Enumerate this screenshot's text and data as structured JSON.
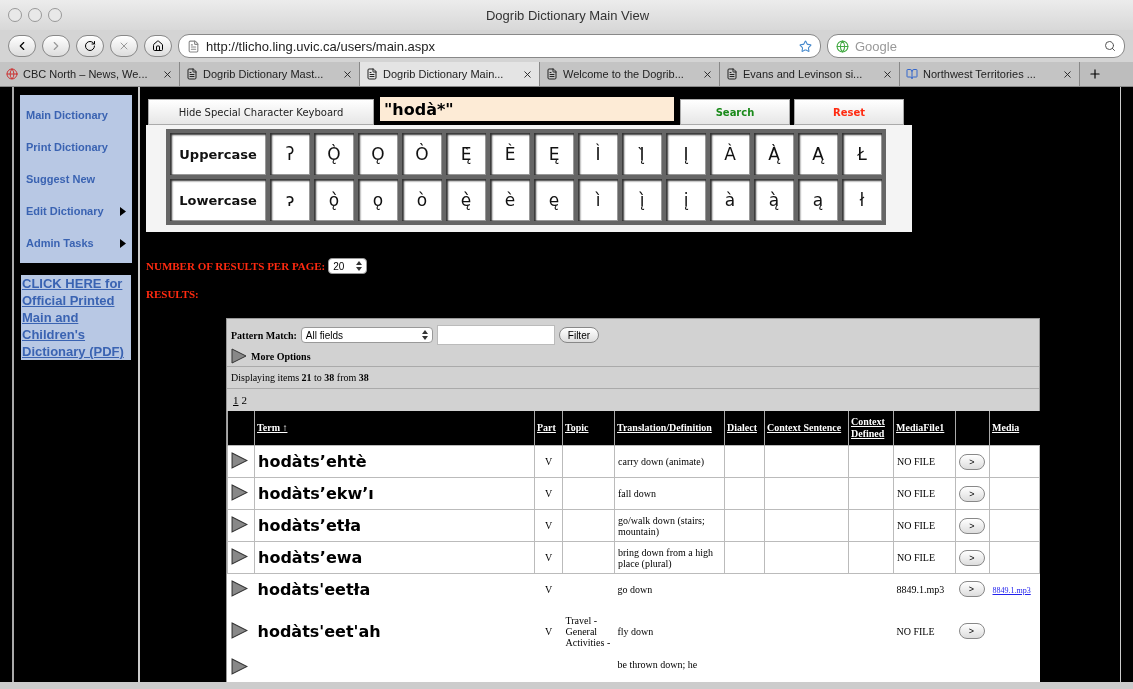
{
  "window": {
    "title": "Dogrib Dictionary Main View"
  },
  "toolbar": {
    "url": "http://tlicho.ling.uvic.ca/users/main.aspx",
    "search_placeholder": "Google"
  },
  "tabs": [
    {
      "label": "CBC North – News, We...",
      "selected": false,
      "kind": "site"
    },
    {
      "label": "Dogrib Dictionary Mast...",
      "selected": false,
      "kind": "page"
    },
    {
      "label": "Dogrib Dictionary Main...",
      "selected": true,
      "kind": "page"
    },
    {
      "label": "Welcome to the Dogrib...",
      "selected": false,
      "kind": "page"
    },
    {
      "label": "Evans and Levinson si...",
      "selected": false,
      "kind": "page"
    },
    {
      "label": "Northwest Territories ...",
      "selected": false,
      "kind": "book"
    }
  ],
  "sidebar": {
    "items": [
      {
        "label": "Main Dictionary",
        "has_submenu": false
      },
      {
        "label": "Print Dictionary",
        "has_submenu": false
      },
      {
        "label": "Suggest New",
        "has_submenu": false
      },
      {
        "label": "Edit Dictionary",
        "has_submenu": true
      },
      {
        "label": "Admin Tasks",
        "has_submenu": true
      }
    ],
    "pdf_link": "CLICK HERE for Official Printed Main and Children's Dictionary (PDF)"
  },
  "search": {
    "keyboard_toggle": "Hide Special Character Keyboard",
    "query": "\"hodà*\"",
    "search_button": "Search",
    "reset_button": "Reset"
  },
  "keyboard": [
    {
      "label": "Uppercase",
      "keys": [
        "ʔ",
        "Ǫ̀",
        "Ǫ",
        "Ò",
        "Ę̀",
        "È",
        "Ę",
        "Ì",
        "Į̀",
        "Į",
        "À",
        "Ą̀",
        "Ą",
        "Ł"
      ]
    },
    {
      "label": "Lowercase",
      "keys": [
        "ɂ",
        "ǫ̀",
        "ǫ",
        "ò",
        "ę̀",
        "è",
        "ę",
        "ì",
        "į̀",
        "į",
        "à",
        "ą̀",
        "ą",
        "ł"
      ]
    }
  ],
  "results_per_page": {
    "label": "NUMBER OF RESULTS PER PAGE:",
    "value": "20"
  },
  "results_label": "RESULTS:",
  "grid": {
    "pattern_label": "Pattern Match:",
    "pattern_select": "All fields",
    "filter_button": "Filter",
    "more_options": "More Options",
    "displaying": "Displaying items **21** to **38** from **38**",
    "pages": [
      {
        "label": "1",
        "selected": false
      },
      {
        "label": "2",
        "selected": true
      }
    ],
    "columns": [
      {
        "label": "Term",
        "sort_mark": "↑"
      },
      {
        "label": "Part"
      },
      {
        "label": "Topic"
      },
      {
        "label": "Translation/Definition"
      },
      {
        "label": "Dialect"
      },
      {
        "label": "Context Sentence"
      },
      {
        "label": "Context Defined"
      },
      {
        "label": "MediaFile1"
      },
      {
        "label": "Media"
      }
    ],
    "rows": [
      {
        "term": "hodàts’ehtè",
        "part": "V",
        "translation": "carry down (animate)",
        "media_file": "NO FILE",
        "button": ">",
        "bordered": true
      },
      {
        "term": "hodàts’ekw’ı",
        "part": "V",
        "translation": "fall down",
        "media_file": "NO FILE",
        "button": ">",
        "bordered": true
      },
      {
        "term": "hodàts’etła",
        "part": "V",
        "translation": "go/walk down (stairs; mountain)",
        "media_file": "NO FILE",
        "button": ">",
        "bordered": true
      },
      {
        "term": "hodàts’ewa",
        "part": "V",
        "translation": "bring down from a high place (plural)",
        "media_file": "NO FILE",
        "button": ">",
        "bordered": true
      },
      {
        "term": "hodàts'eetła",
        "part": "V",
        "translation": "go down",
        "media_file": "8849.1.mp3",
        "button": ">",
        "media_link": "8849.1.mp3",
        "bordered": false
      },
      {
        "term": "hodàts'eet'ah",
        "part": "V",
        "topic": "Travel - General Activities -",
        "translation": "fly down",
        "media_file": "NO FILE",
        "button": ">",
        "bordered": false
      },
      {
        "translation": "be thrown down; he",
        "bordered": false
      }
    ]
  }
}
